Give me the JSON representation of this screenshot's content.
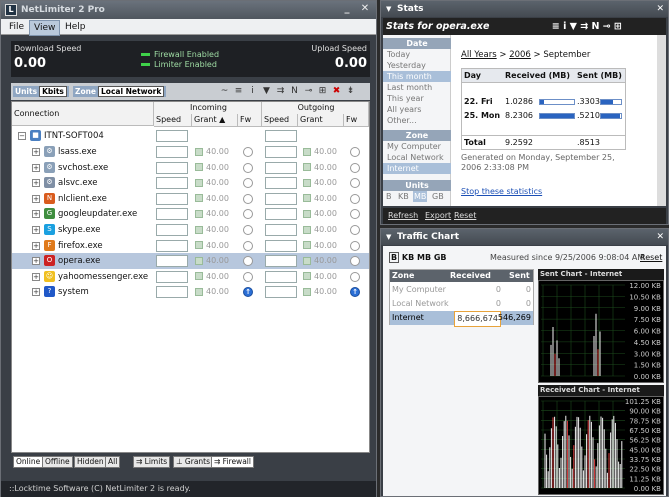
{
  "app": {
    "title": "NetLimiter 2 Pro",
    "logo": "L"
  },
  "menu": [
    "File",
    "View",
    "Help"
  ],
  "speeds": {
    "download_label": "Download Speed",
    "upload_label": "Upload Speed",
    "download_value": "0.00",
    "upload_value": "0.00",
    "firewall_status": "Firewall Enabled",
    "limiter_status": "Limiter Enabled"
  },
  "toolbar": {
    "units_label": "Units",
    "units_value": "Kbits",
    "zone_label": "Zone",
    "zone_value": "Local Network"
  },
  "grid": {
    "connection_header": "Connection",
    "incoming_header": "Incoming",
    "outgoing_header": "Outgoing",
    "speed_header": "Speed",
    "grant_header": "Grant ▲",
    "fw_header": "Fw",
    "speed_header2": "Speed",
    "grant_header2": "Grant",
    "fw_header2": "Fw",
    "root": "ITNT-SOFT004",
    "rows": [
      {
        "name": "lsass.exe",
        "in": "40.00",
        "out": "40.00"
      },
      {
        "name": "svchost.exe",
        "in": "40.00",
        "out": "40.00"
      },
      {
        "name": "alsvc.exe",
        "in": "40.00",
        "out": "40.00"
      },
      {
        "name": "nlclient.exe",
        "in": "40.00",
        "out": "40.00"
      },
      {
        "name": "googleupdater.exe",
        "in": "40.00",
        "out": "40.00"
      },
      {
        "name": "skype.exe",
        "in": "40.00",
        "out": "40.00"
      },
      {
        "name": "firefox.exe",
        "in": "40.00",
        "out": "40.00"
      },
      {
        "name": "opera.exe",
        "in": "40.00",
        "out": "40.00"
      },
      {
        "name": "yahoomessenger.exe",
        "in": "40.00",
        "out": "40.00"
      },
      {
        "name": "system",
        "in": "40.00",
        "out": "40.00"
      }
    ]
  },
  "bottom_tabs": [
    "Online",
    "Offline",
    "Hidden",
    "All"
  ],
  "view_tabs": [
    "Limits",
    "Grants",
    "Firewall"
  ],
  "status": "::Locktime Software (C) NetLimiter 2 is ready.",
  "stats": {
    "panel_title": "Stats",
    "header": "Stats for opera.exe",
    "date_section": "Date",
    "dates": [
      "Today",
      "Yesterday",
      "This month",
      "Last month",
      "This year",
      "All years",
      "Other..."
    ],
    "zone_section": "Zone",
    "zones": [
      "My Computer",
      "Local Network",
      "Internet"
    ],
    "units_section": "Units",
    "units": [
      "B",
      "KB",
      "MB",
      "GB"
    ],
    "breadcrumb_all": "All Years",
    "breadcrumb_sep": " > ",
    "breadcrumb_year": "2006",
    "breadcrumb_month": " > September",
    "col_day": "Day",
    "col_received": "Received (MB)",
    "col_sent": "Sent (MB)",
    "rows": [
      {
        "day": "22. Fri",
        "received": "1.0286",
        "sent": ".3303",
        "rfrac": 0.125,
        "sfrac": 0.6
      },
      {
        "day": "25. Mon",
        "received": "8.2306",
        "sent": ".5210",
        "rfrac": 1.0,
        "sfrac": 0.95
      }
    ],
    "total_label": "Total",
    "total_received": "9.2592",
    "total_sent": ".8513",
    "generated": "Generated on Monday, September 25, 2006 2:33:08 PM",
    "stop_link": "Stop these statistics",
    "footer": [
      "Refresh",
      "Export",
      "Reset"
    ]
  },
  "traffic": {
    "panel_title": "Traffic Chart",
    "units": [
      "B",
      "KB",
      "MB",
      "GB"
    ],
    "measured": "Measured since 9/25/2006 9:08:04 AM",
    "reset": "Reset",
    "col_zone": "Zone",
    "col_received": "Received",
    "col_sent": "Sent",
    "zones": [
      {
        "name": "My Computer",
        "received": "0",
        "sent": "0"
      },
      {
        "name": "Local Network",
        "received": "0",
        "sent": "0"
      },
      {
        "name": "Internet",
        "received": "8,666,674",
        "sent": "546,269"
      }
    ],
    "sent_chart_title": "Sent Chart - Internet",
    "received_chart_title": "Received Chart - Internet",
    "sent_axis": [
      "12.00 KB",
      "10.50 KB",
      "9.00 KB",
      "7.50 KB",
      "6.00 KB",
      "4.50 KB",
      "3.00 KB",
      "1.50 KB",
      "0.00 KB"
    ],
    "received_axis": [
      "101.25 KB",
      "90.00 KB",
      "78.75 KB",
      "67.50 KB",
      "56.25 KB",
      "45.00 KB",
      "33.75 KB",
      "22.50 KB",
      "11.25 KB",
      "0.00 KB"
    ]
  },
  "colors": {
    "accent": "#a9bfd9",
    "dark": "#1e2024",
    "green": "#3fd14a"
  }
}
